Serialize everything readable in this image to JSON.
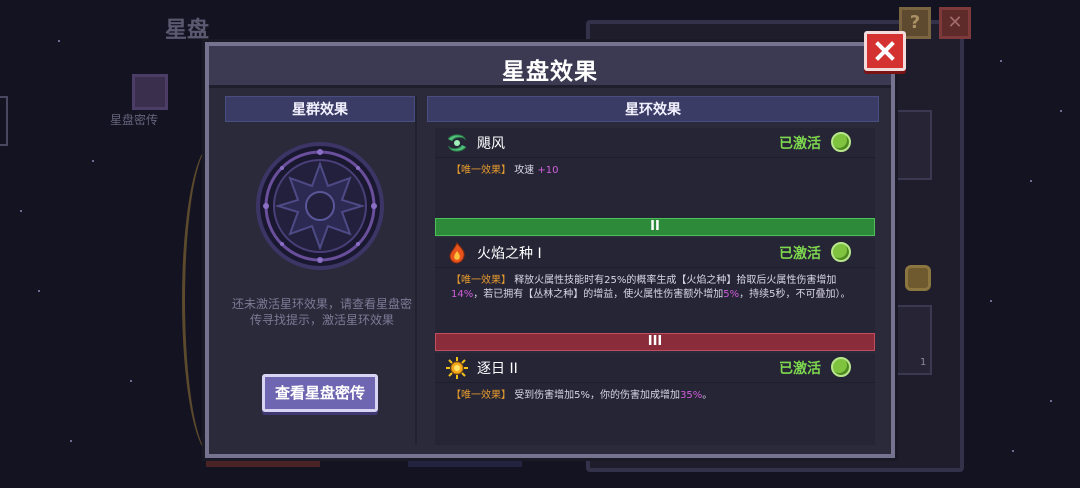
{
  "background": {
    "title": "星盘",
    "icon_label": "星盘密传",
    "help_label": "?",
    "close_label": "✕",
    "slot_count": "1"
  },
  "dialog": {
    "title": "星盘效果",
    "left": {
      "header": "星群效果",
      "hint": "还未激活星环效果，请查看星盘密传寻找提示，激活星环效果",
      "button": "查看星盘密传"
    },
    "right": {
      "header": "星环效果",
      "dividers": [
        "II",
        "III"
      ],
      "rings": [
        {
          "name": "飓风",
          "icon": "whirlwind-icon",
          "status": "已激活",
          "tag": "【唯一效果】",
          "desc_parts": [
            "攻速 ",
            "+10"
          ]
        },
        {
          "name": "火焰之种 I",
          "icon": "fire-seed-icon",
          "status": "已激活",
          "tag": "【唯一效果】",
          "desc_parts": [
            "释放火属性技能时有25%的概率生成【火焰之种】拾取后火属性伤害增加",
            "14%",
            "，若已拥有【丛林之种】的增益，使火属性伤害额外增加",
            "5%",
            "，持续5秒，不可叠加）。"
          ]
        },
        {
          "name": "逐日 II",
          "icon": "sun-icon",
          "status": "已激活",
          "tag": "【唯一效果】",
          "desc_parts": [
            "受到伤害增加5%，你的伤害加成增加",
            "35%",
            "。"
          ]
        }
      ]
    }
  },
  "colors": {
    "active_green": "#7ed84e",
    "tag_orange": "#e59a2d",
    "highlight_purple": "#d15edc",
    "close_red": "#d43230",
    "button_purple": "#6e66b0"
  }
}
